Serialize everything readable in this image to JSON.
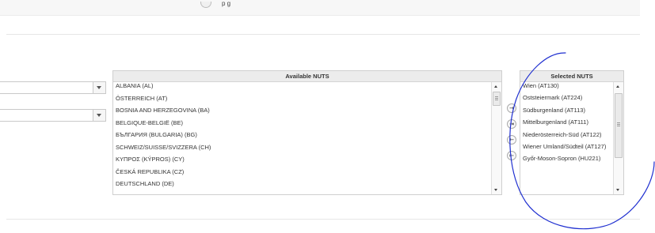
{
  "top_bar": {
    "partial_label": "p   g"
  },
  "dropdown_1": {
    "value": ""
  },
  "dropdown_2": {
    "value": ""
  },
  "available": {
    "title": "Available NUTS",
    "items": [
      "ALBANIA (AL)",
      "ÖSTERREICH (AT)",
      "BOSNIA AND HERZEGOVINA (BA)",
      "BELGIQUE-BELGIË (BE)",
      "БЪЛГАРИЯ (BULGARIA) (BG)",
      "SCHWEIZ/SUISSE/SVIZZERA (CH)",
      "ΚΥΠΡΟΣ (KÝPROS) (CY)",
      "ČESKÁ REPUBLIKA (CZ)",
      "DEUTSCHLAND (DE)"
    ]
  },
  "transfer_buttons": {
    "add": "→",
    "add_all": "⇥",
    "remove": "←",
    "remove_all": "⇤"
  },
  "selected": {
    "title": "Selected NUTS",
    "items": [
      "Wien (AT130)",
      "Oststeiermark (AT224)",
      "Südburgenland (AT113)",
      "Mittelburgenland (AT111)",
      "Niederösterreich-Süd (AT122)",
      "Wiener Umland/Südteil (AT127)",
      "Győr-Moson-Sopron (HU221)"
    ]
  },
  "colors": {
    "annotation": "#1f2fd0",
    "header_bg": "#ececec",
    "border": "#cfcfcf"
  },
  "icons": [
    "chevron-down-icon",
    "arrow-right-icon",
    "arrow-right-all-icon",
    "arrow-left-icon",
    "arrow-left-all-icon"
  ]
}
